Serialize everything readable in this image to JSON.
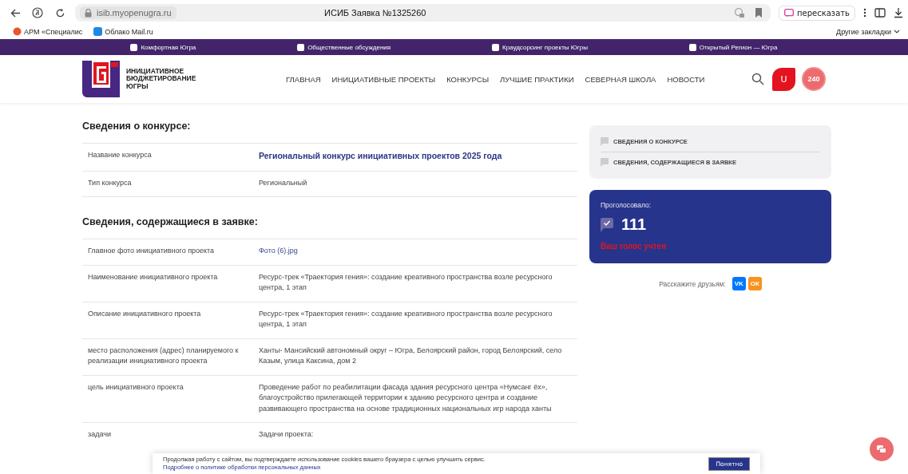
{
  "browser": {
    "address": "isib.myopenugra.ru",
    "title": "ИСИБ Заявка №1325260",
    "retell": "пересказать",
    "bookmarks": [
      "АРМ «Специалис",
      "Облако Mail.ru"
    ],
    "other_bookmarks": "Другие закладки"
  },
  "topbar": [
    "Комфортная Югра",
    "Общественные обсуждения",
    "Краудсорсинг проекты Югры",
    "Открытый Регион — Югра"
  ],
  "header": {
    "logo_text": [
      "ИНИЦИАТИВНОЕ",
      "БЮДЖЕТИРОВАНИЕ",
      "ЮГРЫ"
    ],
    "nav": [
      "ГЛАВНАЯ",
      "ИНИЦИАТИВНЫЕ ПРОЕКТЫ",
      "КОНКУРСЫ",
      "ЛУЧШИЕ ПРАКТИКИ",
      "СЕВЕРНАЯ ШКОЛА",
      "НОВОСТИ"
    ],
    "avatar": "U",
    "badge": "240"
  },
  "sections": [
    {
      "title": "Сведения о конкурсе:",
      "rows": [
        {
          "label": "Название конкурса",
          "value": "Региональный конкурс инициативных проектов 2025 года",
          "kind": "heading"
        },
        {
          "label": "Тип конкурса",
          "value": "Региональный",
          "kind": "text"
        }
      ]
    },
    {
      "title": "Сведения, содержащиеся в заявке:",
      "rows": [
        {
          "label": "Главное фото инициативного проекта",
          "value": "Фото (6).jpg",
          "kind": "link"
        },
        {
          "label": "Наименование инициативного проекта",
          "value": "Ресурс-трек «Траектория гения»: создание креативного пространства возле ресурсного центра, 1 этап",
          "kind": "text"
        },
        {
          "label": "Описание инициативного проекта",
          "value": "Ресурс-трек «Траектория гения»: создание креативного пространства возле ресурсного центра, 1 этап",
          "kind": "text"
        },
        {
          "label": "место расположения (адрес) планируемого к реализации инициативного проекта",
          "value": "Ханты- Мансийский автономный округ – Югра, Белоярский район, город Белоярский, село Казым, улица Каксина, дом 2",
          "kind": "text"
        },
        {
          "label": "цель инициативного проекта",
          "value": "Проведение работ по реабилитации фасада здания ресурсного центра «Нумсанг ёх», благоустройство прилегающей территории к зданию ресурсного центра и создание развивающего пространства на основе традиционных национальных игр народа ханты",
          "kind": "text"
        },
        {
          "label": "задачи",
          "value": "Задачи проекта:",
          "kind": "text"
        }
      ]
    }
  ],
  "side_nav": [
    "СВЕДЕНИЯ О КОНКУРСЕ",
    "СВЕДЕНИЯ, СОДЕРЖАЩИЕСЯ В ЗАЯВКЕ"
  ],
  "votes": {
    "label": "Проголосовало:",
    "count": "111",
    "voted": true,
    "message": "Ваш голос учтен"
  },
  "share": {
    "label": "Расскажите друзьям:",
    "networks": [
      {
        "text": "VK",
        "color": "#0077ff"
      },
      {
        "text": "ОК",
        "color": "#f7931e"
      }
    ]
  },
  "cookie": {
    "text": "Продолжая работу с сайтом, вы подтверждаете использование cookies вашего браузера с целью улучшить сервис.",
    "link": "Подробнее о политике обработки персональных данных",
    "button": "Понятно"
  }
}
